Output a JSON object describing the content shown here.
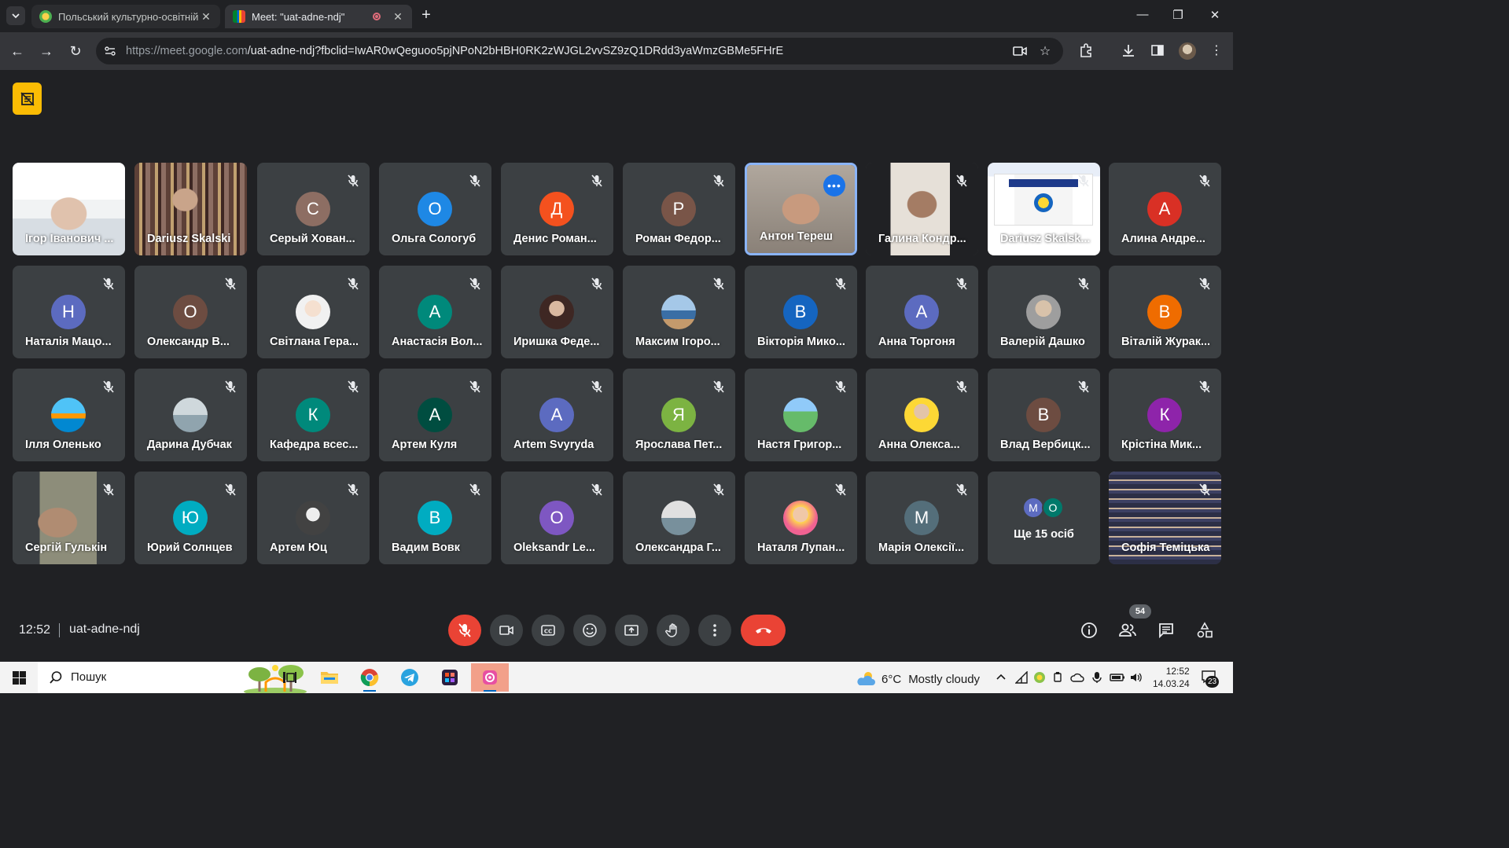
{
  "browser": {
    "tabs": [
      {
        "title": "Польський культурно-освітній",
        "active": false
      },
      {
        "title": "Meet: \"uat-adne-ndj\"",
        "active": true
      }
    ],
    "url_host": "https://meet.google.com",
    "url_path": "/uat-adne-ndj?fbclid=IwAR0wQeguoo5pjNPoN2bHBH0RK2zWJGL2vvSZ9zQ1DRdd3yaWmzGBMe5FHrE"
  },
  "meet": {
    "time": "12:52",
    "code": "uat-adne-ndj",
    "participant_count": "54",
    "more_label": "Ще 15 осіб",
    "more_initials": [
      "М",
      "О"
    ],
    "more_colors": [
      "#5c6bc0",
      "#00796b"
    ],
    "participants": [
      {
        "name": "Ігор Іванович ...",
        "type": "video",
        "muted": false
      },
      {
        "name": "Dariusz Skalski",
        "type": "video",
        "muted": false
      },
      {
        "name": "Серый Хован...",
        "initial": "С",
        "color": "#8d6e63",
        "muted": true
      },
      {
        "name": "Ольга Сологуб",
        "initial": "О",
        "color": "#1e88e5",
        "muted": true
      },
      {
        "name": "Денис Роман...",
        "initial": "Д",
        "color": "#f4511e",
        "muted": true
      },
      {
        "name": "Роман Федор...",
        "initial": "Р",
        "color": "#795548",
        "muted": true
      },
      {
        "name": "Антон Тереш",
        "type": "video",
        "muted": false,
        "speaking": true
      },
      {
        "name": "Галина Кондр...",
        "type": "video",
        "muted": true
      },
      {
        "name": "Dariusz Skalsk...",
        "type": "screen",
        "muted": true
      },
      {
        "name": "Алина Андре...",
        "initial": "А",
        "color": "#d93025",
        "muted": true
      },
      {
        "name": "Наталія Мацо...",
        "initial": "Н",
        "color": "#5c6bc0",
        "muted": true
      },
      {
        "name": "Олександр В...",
        "initial": "О",
        "color": "#6d4c41",
        "muted": true
      },
      {
        "name": "Світлана Гера...",
        "type": "photo",
        "muted": true
      },
      {
        "name": "Анастасія Вол...",
        "initial": "А",
        "color": "#00897b",
        "muted": true
      },
      {
        "name": "Иришка Феде...",
        "type": "photo",
        "muted": true
      },
      {
        "name": "Максим Ігоро...",
        "type": "photo",
        "muted": true
      },
      {
        "name": "Вікторія Мико...",
        "initial": "В",
        "color": "#1565c0",
        "muted": true
      },
      {
        "name": "Анна Торгоня",
        "initial": "А",
        "color": "#5c6bc0",
        "muted": true
      },
      {
        "name": "Валерій Дашко",
        "type": "photo",
        "muted": true
      },
      {
        "name": "Віталій Журак...",
        "initial": "В",
        "color": "#ef6c00",
        "muted": true
      },
      {
        "name": "Ілля Оленько",
        "type": "photo",
        "muted": true
      },
      {
        "name": "Дарина Дубчак",
        "type": "photo",
        "muted": true
      },
      {
        "name": "Кафедра всес...",
        "initial": "К",
        "color": "#00897b",
        "muted": true
      },
      {
        "name": "Артем Куля",
        "initial": "А",
        "color": "#004d40",
        "muted": true
      },
      {
        "name": "Artem Svyryda",
        "initial": "А",
        "color": "#5c6bc0",
        "muted": true
      },
      {
        "name": "Ярослава Пет...",
        "initial": "Я",
        "color": "#7cb342",
        "muted": true
      },
      {
        "name": "Настя Григор...",
        "type": "photo",
        "muted": true
      },
      {
        "name": "Анна Олекса...",
        "type": "photo",
        "muted": true
      },
      {
        "name": "Влад Вербицк...",
        "initial": "В",
        "color": "#6d4c41",
        "muted": true
      },
      {
        "name": "Крістіна Мик...",
        "initial": "К",
        "color": "#8e24aa",
        "muted": true
      },
      {
        "name": "Сергій Гулькін",
        "type": "video",
        "muted": true
      },
      {
        "name": "Юрий Солнцев",
        "initial": "Ю",
        "color": "#00acc1",
        "muted": true
      },
      {
        "name": "Артем Юц",
        "type": "photo",
        "muted": true
      },
      {
        "name": "Вадим Вовк",
        "initial": "В",
        "color": "#00acc1",
        "muted": true
      },
      {
        "name": "Oleksandr Le...",
        "initial": "О",
        "color": "#7e57c2",
        "muted": true
      },
      {
        "name": "Олександра Г...",
        "type": "photo",
        "muted": true
      },
      {
        "name": "Наталя Лупан...",
        "type": "photo",
        "muted": true
      },
      {
        "name": "Марія Олексії...",
        "initial": "М",
        "color": "#546e7a",
        "muted": true
      },
      {
        "name": "Ще 15 осіб",
        "type": "more",
        "muted": false
      },
      {
        "name": "Софія Теміцька",
        "type": "video",
        "muted": true
      }
    ]
  },
  "taskbar": {
    "search_placeholder": "Пошук",
    "weather_temp": "6°C",
    "weather_text": "Mostly cloudy",
    "time": "12:52",
    "date": "14.03.24",
    "notifications": "23"
  }
}
